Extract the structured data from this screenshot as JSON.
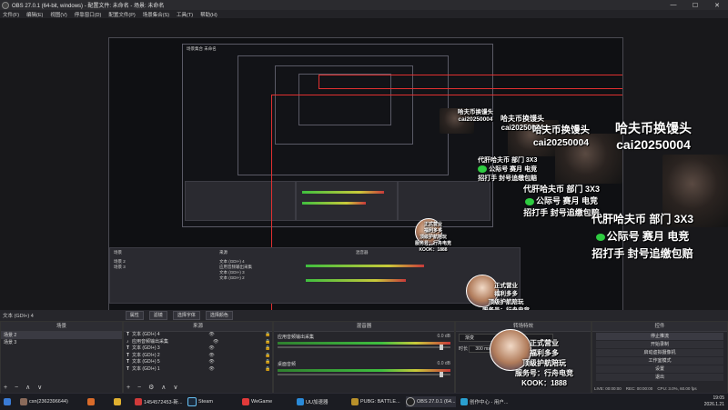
{
  "window": {
    "title": "OBS 27.0.1 (64-bit, windows) - 配置文件: 未命名 - 场景: 未命名"
  },
  "menu": [
    "文件(F)",
    "编辑(E)",
    "视图(V)",
    "停靠窗口(D)",
    "配置文件(P)",
    "场景集合(S)",
    "工具(T)",
    "帮助(H)"
  ],
  "preview_text": {
    "inner_window_title": "场景集合 未命名",
    "overlay": {
      "line1": "哈夫币换馒头",
      "line2": "cai20250004",
      "line3": "代肝哈夫币 部门 3X3",
      "line4": "公际号 赛月 电竞",
      "line5": "招打手 封号追缴包赔"
    },
    "sticker": {
      "l1": "正式营业",
      "l2": "福利多多",
      "l3": "顶级护航陪玩",
      "l4": "服务号：行舟电竞",
      "l5": "KOOK：1888"
    }
  },
  "source_bar": {
    "selected": "文本 (GDI+) 4",
    "buttons": [
      "属性",
      "滤镜",
      "选择字体",
      "选择颜色"
    ]
  },
  "docks": {
    "scenes": {
      "header": "场景",
      "items": [
        "场景 2",
        "场景 3"
      ]
    },
    "sources": {
      "header": "来源",
      "items": [
        "文本 (GDI+) 4",
        "应用音频输出采集",
        "文本 (GDI+) 3",
        "文本 (GDI+) 2",
        "文本 (GDI+) 5",
        "文本 (GDI+) 1"
      ]
    },
    "mixer": {
      "header": "混音器",
      "channels": [
        {
          "name": "应用音频输出采集",
          "db": "0.0 dB"
        },
        {
          "name": "桌面音频",
          "db": "0.0 dB"
        }
      ]
    },
    "transitions": {
      "header": "转场特效",
      "type": "渐变",
      "duration_label": "时长",
      "duration": "300 ms"
    },
    "controls": {
      "header": "控件",
      "buttons": [
        "停止推流",
        "开始录制",
        "启动虚拟摄像机",
        "工作室模式",
        "设置",
        "退出"
      ]
    }
  },
  "status": {
    "live": "LIVE: 00:00:00",
    "rec": "REC: 00:00:00",
    "cpu": "CPU: 3.0%, 60.00 fps",
    "kbps": "kb/s: 0"
  },
  "taskbar": {
    "items": [
      "csn(2362396644)",
      "",
      "1454572453-新...",
      "Steam",
      "WeGame",
      "UU加速器",
      "PUBG: BATTLE...",
      "OBS 27.0.1 (64...",
      "创作中心 - 用户..."
    ],
    "time": "19:05",
    "date": "2026.1.21"
  },
  "colors": {
    "accent_red": "#e03030",
    "accent_blue": "#3a6ee8",
    "overlay_green": "#2ecc40"
  }
}
